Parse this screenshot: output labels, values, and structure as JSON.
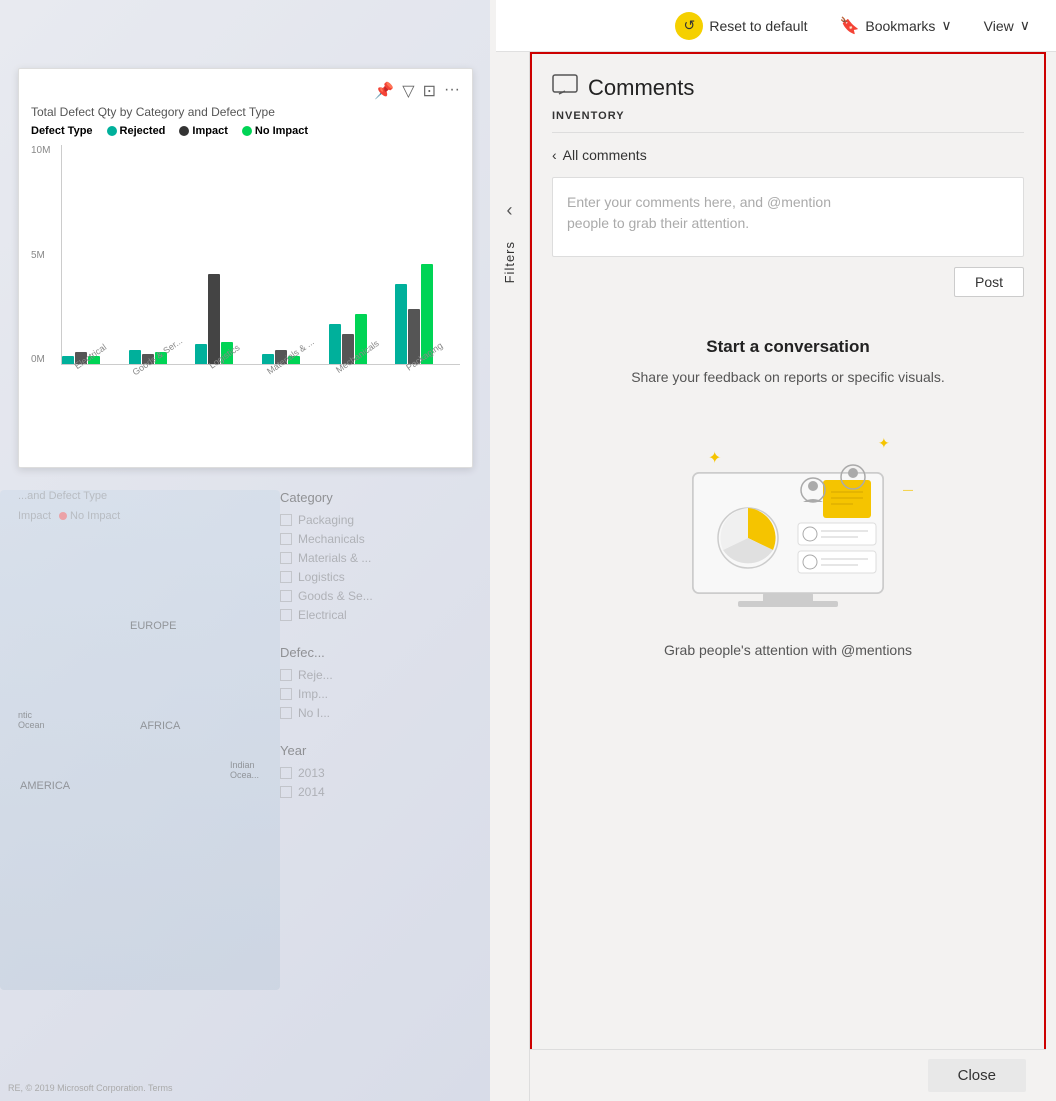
{
  "toolbar": {
    "reset_label": "Reset to default",
    "bookmarks_label": "Bookmarks",
    "view_label": "View",
    "chevron": "∨"
  },
  "chart": {
    "title": "Total Defect Qty by Category and Defect Type",
    "legend_label": "Defect Type",
    "legend_items": [
      {
        "label": "Rejected",
        "color": "#00b09b"
      },
      {
        "label": "Impact",
        "color": "#333"
      },
      {
        "label": "No Impact",
        "color": "#00d455"
      }
    ],
    "y_labels": [
      "10M",
      "5M",
      "0M"
    ],
    "categories": [
      "Electrical",
      "Goods & Ser...",
      "Logistics",
      "Materials & ...",
      "Mechanicals",
      "Packaging"
    ],
    "bars": [
      {
        "rejected": 8,
        "impact": 12,
        "no_impact": 8
      },
      {
        "rejected": 14,
        "impact": 10,
        "no_impact": 12
      },
      {
        "rejected": 20,
        "impact": 90,
        "no_impact": 22
      },
      {
        "rejected": 10,
        "impact": 14,
        "no_impact": 8
      },
      {
        "rejected": 40,
        "impact": 30,
        "no_impact": 50
      },
      {
        "rejected": 80,
        "impact": 60,
        "no_impact": 100
      }
    ]
  },
  "filters_label": "Filters",
  "filter_panel": {
    "category_title": "Category",
    "categories": [
      "Packaging",
      "Mechanicals",
      "Materials & ...",
      "Logistics",
      "Goods & Se...",
      "Electrical"
    ],
    "defect_title": "Defec...",
    "defects": [
      "Reje...",
      "Imp...",
      "No I..."
    ],
    "year_title": "Year",
    "years": [
      "2013",
      "2014"
    ]
  },
  "comments": {
    "title": "Comments",
    "section_label": "INVENTORY",
    "back_label": "All comments",
    "input_placeholder": "Enter your comments here, and @mention\npeople to grab their attention.",
    "post_button": "Post",
    "conversation_title": "Start a conversation",
    "conversation_desc": "Share your feedback on reports or specific visuals.",
    "grab_attention": "Grab people's attention with @mentions",
    "close_button": "Close"
  },
  "map": {
    "europe_label": "EUROPE",
    "africa_label": "AFRICA",
    "america_label": "AMERICA",
    "ocean1": "ntic\nOcean",
    "ocean2": "Indian\nOcear"
  },
  "copyright": "RE, © 2019 Microsoft Corporation. Terms"
}
